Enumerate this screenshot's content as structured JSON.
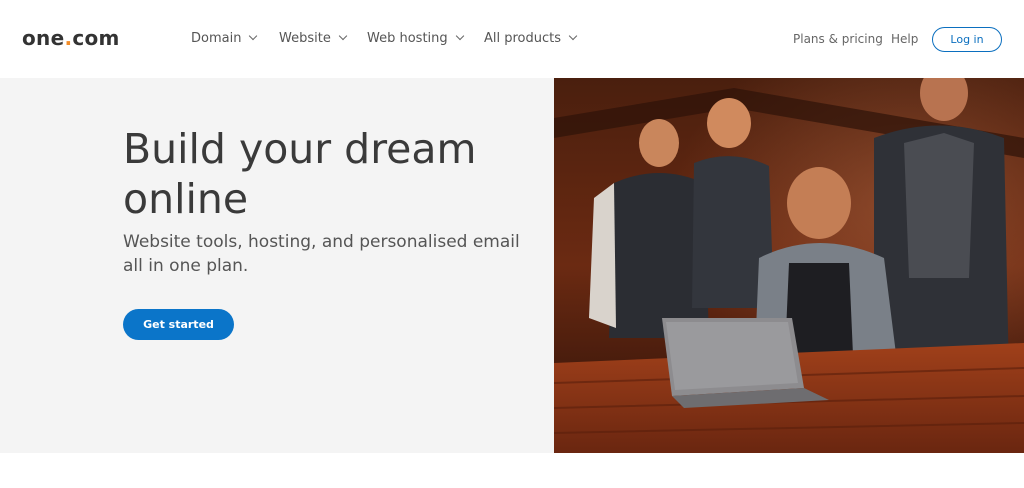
{
  "brand": {
    "name_main": "one",
    "name_dot": ".",
    "name_tld": "com"
  },
  "nav": {
    "items": [
      {
        "label": "Domain"
      },
      {
        "label": "Website"
      },
      {
        "label": "Web hosting"
      },
      {
        "label": "All products"
      }
    ],
    "plans_label": "Plans & pricing",
    "help_label": "Help",
    "login_label": "Log in"
  },
  "hero": {
    "title": "Build your dream online",
    "subtitle": "Website tools, hosting, and personalised email all in one plan.",
    "cta_label": "Get started",
    "image_icon": "people-laptop-photo"
  },
  "colors": {
    "accent": "#0b75c9",
    "logo_dot": "#f28c28",
    "hero_bg": "#f4f4f4"
  }
}
